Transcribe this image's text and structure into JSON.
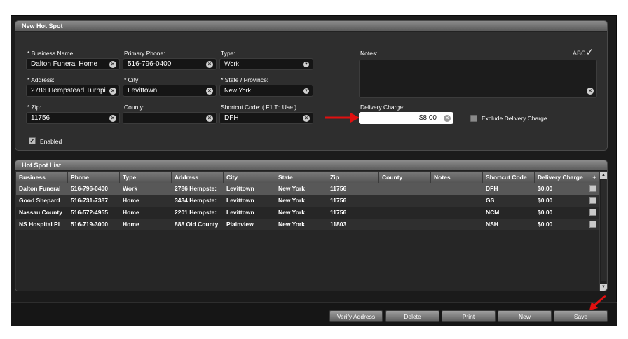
{
  "new_hot_spot": {
    "title": "New Hot Spot",
    "business_name": {
      "label": "* Business Name:",
      "value": "Dalton Funeral Home"
    },
    "primary_phone": {
      "label": "Primary Phone:",
      "value": "516-796-0400"
    },
    "type": {
      "label": "Type:",
      "value": "Work"
    },
    "address": {
      "label": "* Address:",
      "value": "2786 Hempstead Turnpi"
    },
    "city": {
      "label": "* City:",
      "value": "Levittown"
    },
    "state": {
      "label": "* State / Province:",
      "value": "New York"
    },
    "zip": {
      "label": "* Zip:",
      "value": "11756"
    },
    "county": {
      "label": "County:",
      "value": ""
    },
    "shortcut_code": {
      "label": "Shortcut Code: ( F1 To Use )",
      "value": "DFH"
    },
    "notes": {
      "label": "Notes:",
      "value": ""
    },
    "spellcheck": {
      "label": "ABC",
      "mark": "✓"
    },
    "delivery_charge": {
      "label": "Delivery Charge:",
      "value": "$8.00"
    },
    "exclude_delivery": {
      "label": "Exclude Delivery Charge",
      "checked": false
    },
    "enabled": {
      "label": "Enabled",
      "checked": true
    }
  },
  "hot_spot_list": {
    "title": "Hot Spot List",
    "columns": [
      "Business",
      "Phone",
      "Type",
      "Address",
      "City",
      "State",
      "Zip",
      "County",
      "Notes",
      "Shortcut Code",
      "Delivery Charge",
      "+"
    ],
    "rows": [
      [
        "Dalton Funeral",
        "516-796-0400",
        "Work",
        "2786 Hempste:",
        "Levittown",
        "New York",
        "11756",
        "",
        "",
        "DFH",
        "$0.00"
      ],
      [
        "Good Shepard",
        "516-731-7387",
        "Home",
        "3434 Hempste:",
        "Levittown",
        "New York",
        "11756",
        "",
        "",
        "GS",
        "$0.00"
      ],
      [
        "Nassau County",
        "516-572-4955",
        "Home",
        "2201 Hempste:",
        "Levittown",
        "New York",
        "11756",
        "",
        "",
        "NCM",
        "$0.00"
      ],
      [
        "NS Hospital Pl",
        "516-719-3000",
        "Home",
        "888 Old County",
        "Plainview",
        "New York",
        "11803",
        "",
        "",
        "NSH",
        "$0.00"
      ]
    ]
  },
  "footer": {
    "verify_address": "Verify Address",
    "delete": "Delete",
    "print": "Print",
    "new": "New",
    "save": "Save"
  },
  "colors": {
    "annotation_arrow": "#e01010",
    "selected_row": "#585858",
    "background": "#1b1b1b"
  }
}
